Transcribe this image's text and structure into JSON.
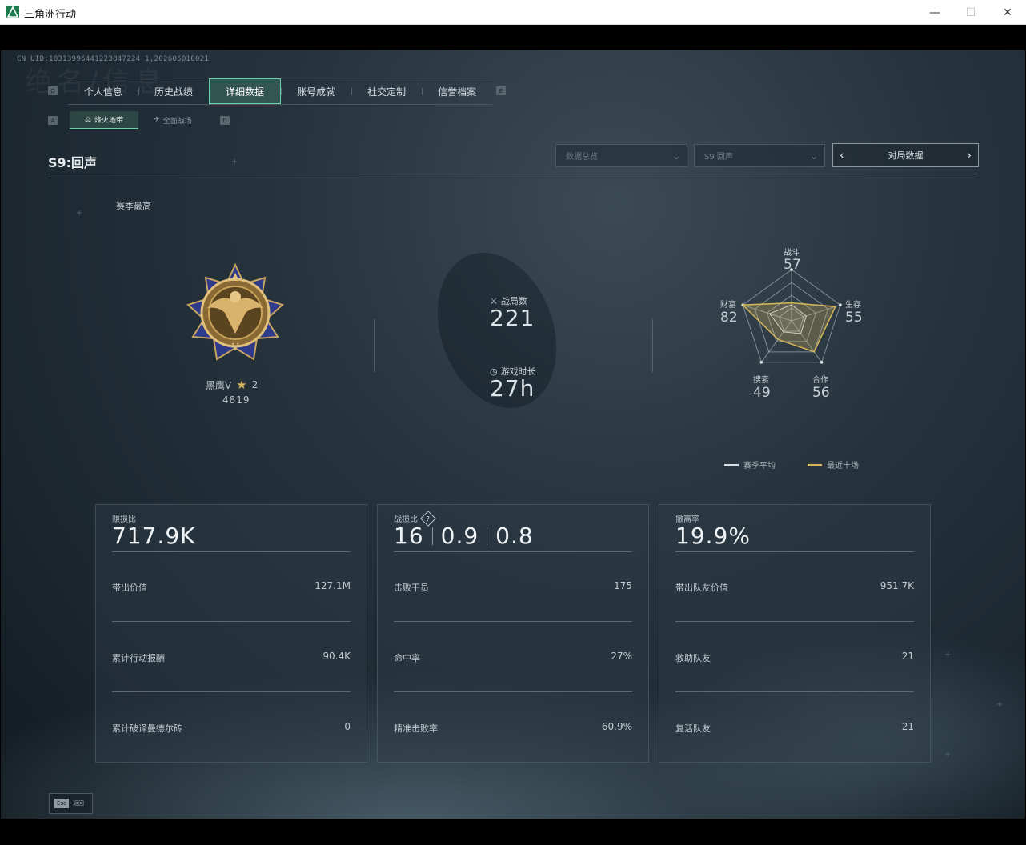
{
  "window": {
    "title": "三角洲行动",
    "minimize": "—",
    "maximize": "☐",
    "close": "✕"
  },
  "uid": "CN UID:18313996441223847224 1,202605010021",
  "bg_glyph": "绝名/信息",
  "tabs": [
    {
      "label": "个人信息"
    },
    {
      "label": "历史战绩"
    },
    {
      "label": "详细数据",
      "active": true
    },
    {
      "label": "账号成就"
    },
    {
      "label": "社交定制"
    },
    {
      "label": "信誉档案"
    }
  ],
  "key_hints": {
    "tab_left": "Q",
    "tab_right": "E",
    "sub_left": "A",
    "sub_right": "D"
  },
  "subtabs": [
    {
      "label": "烽火地带",
      "active": true
    },
    {
      "label": "全面战场"
    }
  ],
  "season_title": "S9:回声",
  "dropdowns": {
    "overview": "数据总览",
    "season": "S9 回声"
  },
  "match_nav": {
    "label": "对局数据",
    "prev": "‹",
    "next": "›"
  },
  "season_best": "赛季最高",
  "rank": {
    "name": "黑鹰V",
    "stars": "2",
    "score": "4819"
  },
  "battles": {
    "label": "战局数",
    "value": "221"
  },
  "playtime": {
    "label": "游戏时长",
    "value": "27h"
  },
  "radar": {
    "axes": [
      {
        "label": "战斗",
        "value": "57",
        "recent": 0.35
      },
      {
        "label": "生存",
        "value": "55",
        "recent": 0.9
      },
      {
        "label": "合作",
        "value": "56",
        "recent": 0.75
      },
      {
        "label": "搜索",
        "value": "49",
        "recent": 0.45
      },
      {
        "label": "财富",
        "value": "82",
        "recent": 1.0
      }
    ],
    "season_avg_color": "#d8dde0",
    "recent_color": "#d8b75a"
  },
  "legend": {
    "season_avg": "赛季平均",
    "recent_ten": "最近十场"
  },
  "cards": [
    {
      "title": "赚损比",
      "big": "717.9K",
      "rows": [
        {
          "label": "带出价值",
          "value": "127.1M"
        },
        {
          "label": "累计行动报酬",
          "value": "90.4K"
        },
        {
          "label": "累计破译曼德尔砖",
          "value": "0"
        }
      ]
    },
    {
      "title": "战损比",
      "big_parts": [
        "16",
        "0.9",
        "0.8"
      ],
      "help": "?",
      "rows": [
        {
          "label": "击败干员",
          "value": "175"
        },
        {
          "label": "命中率",
          "value": "27%"
        },
        {
          "label": "精准击败率",
          "value": "60.9%"
        }
      ]
    },
    {
      "title": "撤离率",
      "big": "19.9%",
      "rows": [
        {
          "label": "带出队友价值",
          "value": "951.7K"
        },
        {
          "label": "救助队友",
          "value": "21"
        },
        {
          "label": "复活队友",
          "value": "21"
        }
      ]
    }
  ],
  "esc": {
    "key": "Esc",
    "label": "返回"
  },
  "colors": {
    "accent": "#6ad0a6",
    "gold": "#d8b75a"
  }
}
